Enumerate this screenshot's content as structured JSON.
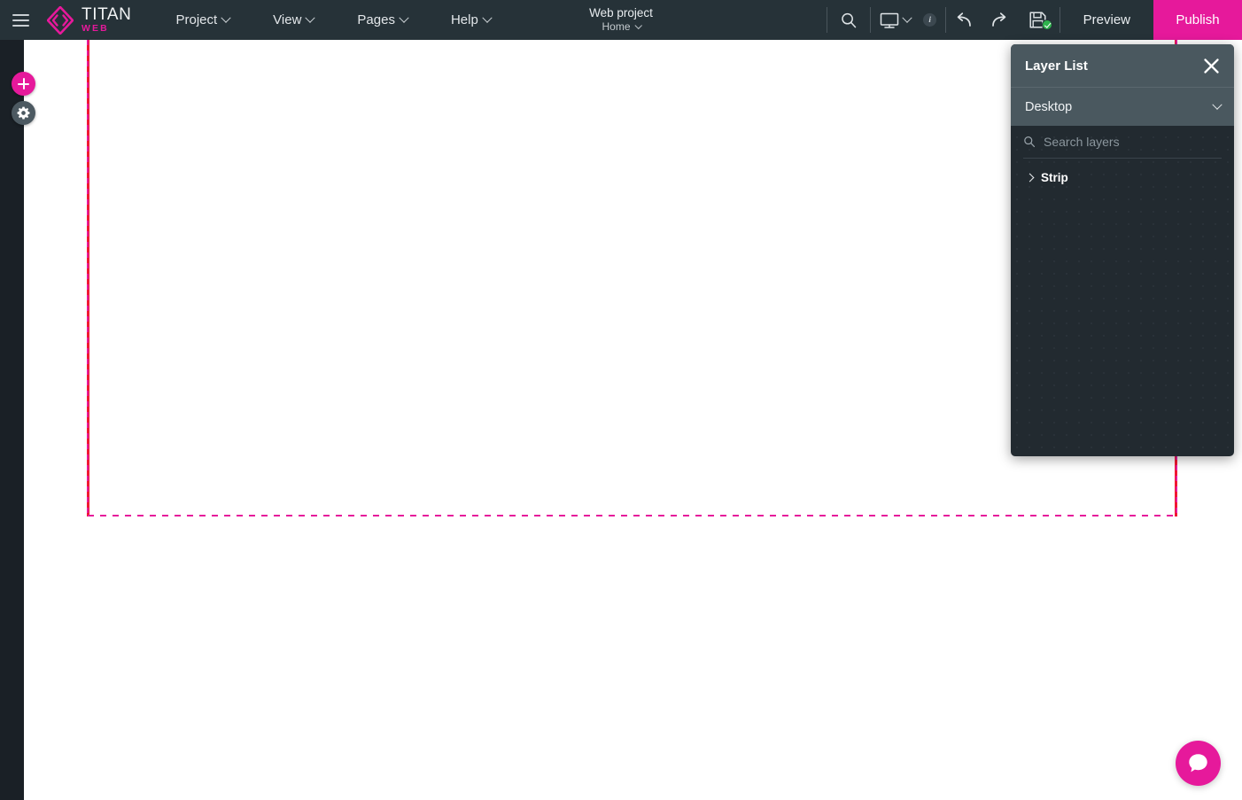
{
  "app": {
    "logo_title": "TITAN",
    "logo_subtitle": "WEB",
    "brand_color": "#e6199b",
    "topbar_color": "#263238"
  },
  "topbar": {
    "hamburger_icon": "hamburger-menu-icon",
    "menus": [
      {
        "label": "Project",
        "icon": "chevron-down-icon"
      },
      {
        "label": "View",
        "icon": "chevron-down-icon"
      },
      {
        "label": "Pages",
        "icon": "chevron-down-icon"
      },
      {
        "label": "Help",
        "icon": "chevron-down-icon"
      }
    ],
    "project_name": "Web project",
    "page_name": "Home",
    "tools": [
      {
        "name": "search-icon",
        "label": "Search"
      },
      {
        "name": "desktop-device-icon",
        "label": "Desktop"
      },
      {
        "name": "info-icon",
        "label": "i"
      },
      {
        "name": "undo-icon",
        "label": "Undo"
      },
      {
        "name": "redo-icon",
        "label": "Redo"
      },
      {
        "name": "save-icon",
        "label": "Save"
      }
    ],
    "info_badge_text": "i",
    "preview_label": "Preview",
    "publish_label": "Publish",
    "publish_color": "#e6199b"
  },
  "left_rail": {
    "add_label": "+",
    "add_icon": "plus-icon",
    "add_color": "#e6199b",
    "settings_icon": "gear-icon",
    "settings_color": "#4c5961"
  },
  "canvas": {
    "guide_solid_color": "#f01932",
    "guide_dashed_color": "#e6199b"
  },
  "layer_panel": {
    "title": "Layer List",
    "close_icon": "close-icon",
    "viewport": {
      "selected": "Desktop",
      "icon": "chevron-down-icon",
      "options": [
        "Desktop"
      ]
    },
    "search": {
      "icon": "search-icon",
      "placeholder": "Search layers",
      "value": ""
    },
    "layers": [
      {
        "name": "Strip",
        "expand_icon": "chevron-right-icon",
        "expanded": false
      }
    ]
  },
  "chat": {
    "icon": "chat-bubble-icon",
    "color": "#e6199b"
  }
}
